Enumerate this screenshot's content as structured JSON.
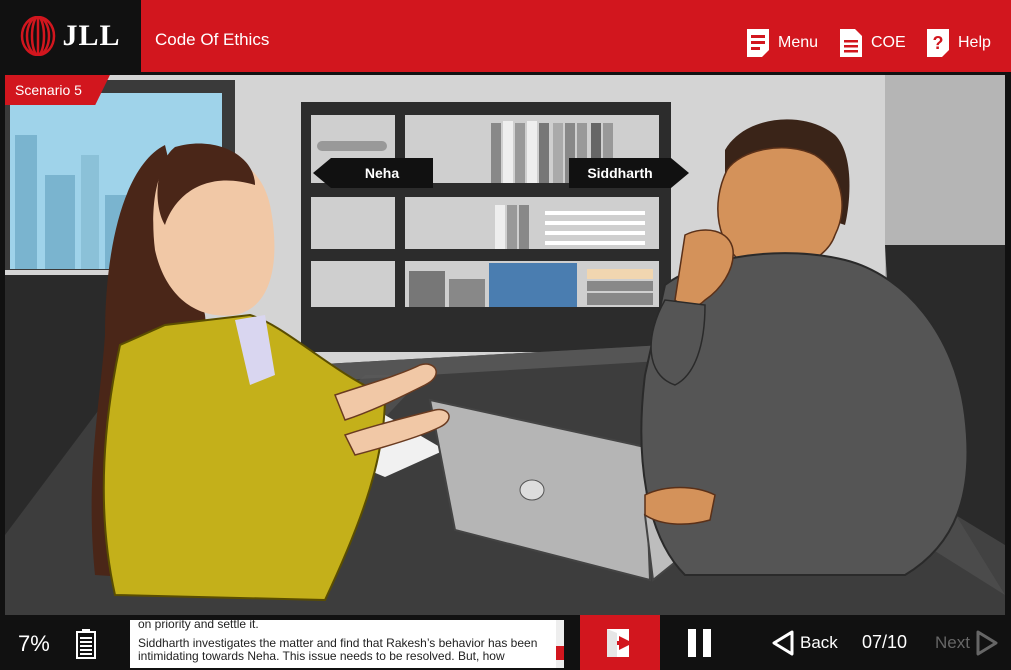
{
  "header": {
    "logo_text": "JLL",
    "title": "Code Of Ethics",
    "menu_label": "Menu",
    "coe_label": "COE",
    "help_label": "Help"
  },
  "stage": {
    "scenario_label": "Scenario 5",
    "character_left": "Neha",
    "character_right": "Siddharth"
  },
  "footer": {
    "progress_text": "7%",
    "transcript_line0": "on priority and settle it.",
    "transcript_line1": "Siddharth investigates the matter and find that Rakesh’s behavior has been intimidating towards Neha. This issue needs to be resolved. But, how",
    "back_label": "Back",
    "page_counter": "07/10",
    "next_label": "Next"
  },
  "colors": {
    "brand_red": "#d2161e",
    "dark": "#111111"
  }
}
